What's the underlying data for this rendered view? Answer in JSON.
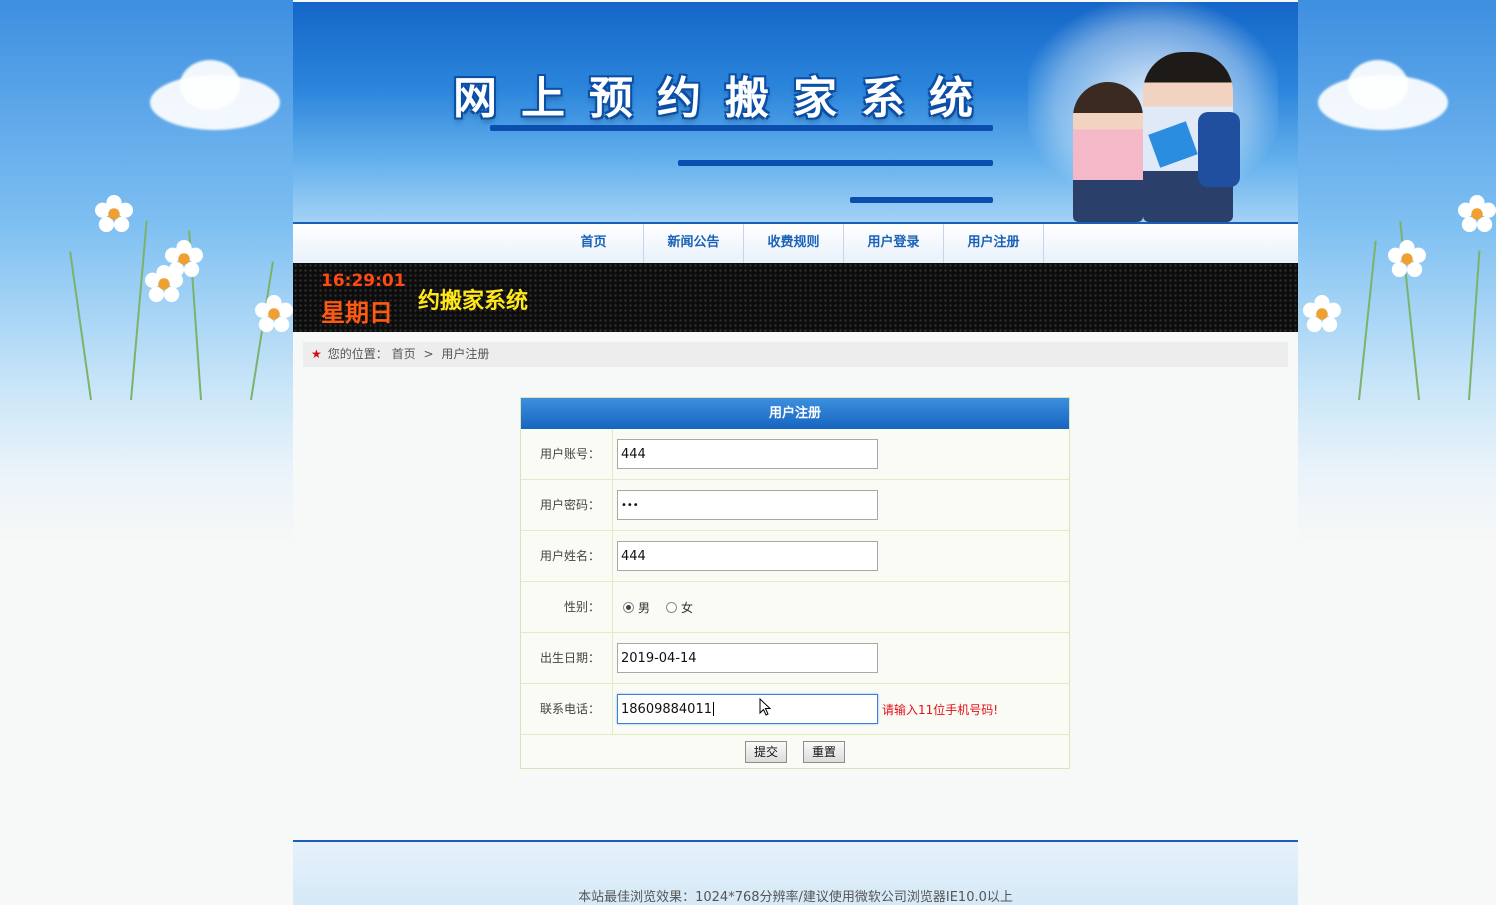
{
  "banner": {
    "title": "网上预约搬家系统"
  },
  "nav": {
    "items": [
      {
        "label": "首页"
      },
      {
        "label": "新闻公告"
      },
      {
        "label": "收费规则"
      },
      {
        "label": "用户登录"
      },
      {
        "label": "用户注册"
      }
    ]
  },
  "led": {
    "time": "16:29:01",
    "weekday": "星期日",
    "marquee": "约搬家系统"
  },
  "breadcrumb": {
    "prefix": "您的位置：",
    "home": "首页",
    "separator": ">",
    "current": "用户注册"
  },
  "form": {
    "title": "用户注册",
    "account": {
      "label": "用户账号：",
      "value": "444"
    },
    "password": {
      "label": "用户密码：",
      "value": "•••"
    },
    "name": {
      "label": "用户姓名：",
      "value": "444"
    },
    "gender": {
      "label": "性别：",
      "male": "男",
      "female": "女",
      "selected": "男"
    },
    "birthday": {
      "label": "出生日期：",
      "value": "2019-04-14"
    },
    "phone": {
      "label": "联系电话：",
      "value": "18609884011",
      "error": "请输入11位手机号码!"
    },
    "submit": "提交",
    "reset": "重置"
  },
  "footer": {
    "text": "本站最佳浏览效果：1024*768分辨率/建议使用微软公司浏览器IE10.0以上"
  },
  "colors": {
    "brand": "#1a62b8",
    "error": "#e0101c",
    "led_time": "#ff4a12",
    "led_marquee": "#ffe71a"
  }
}
